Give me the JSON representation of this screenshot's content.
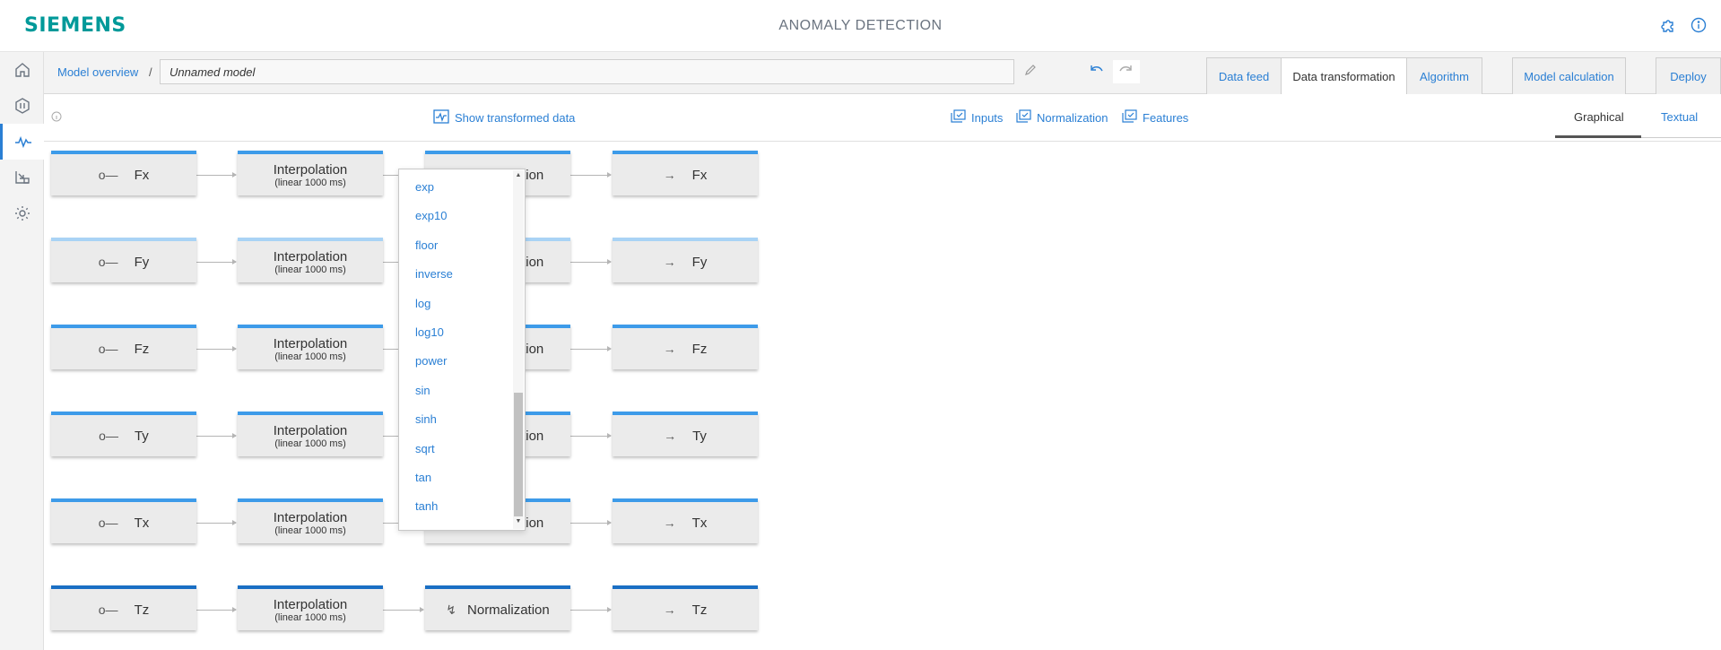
{
  "header": {
    "logo": "SIEMENS",
    "title": "ANOMALY DETECTION",
    "icons": [
      "puzzle-icon",
      "info-icon"
    ]
  },
  "rail": {
    "items": [
      {
        "name": "home-icon",
        "active": false
      },
      {
        "name": "hexagon-icon",
        "active": false
      },
      {
        "name": "signal-icon",
        "active": true
      },
      {
        "name": "import-icon",
        "active": false
      },
      {
        "name": "gear-icon",
        "active": false
      }
    ]
  },
  "toolbar": {
    "breadcrumb": "Model overview",
    "separator": "/",
    "model_name": "Unnamed model",
    "tabs": [
      "Data feed",
      "Data transformation",
      "Algorithm",
      "Model calculation",
      "Deploy"
    ],
    "active_tab": "Data transformation"
  },
  "subbar": {
    "show_transformed": "Show transformed data",
    "links": [
      "Inputs",
      "Normalization",
      "Features"
    ],
    "views": [
      "Graphical",
      "Textual"
    ],
    "active_view": "Graphical"
  },
  "pipeline": {
    "interp_title": "Interpolation",
    "interp_sub": "(linear 1000 ms)",
    "norm_title": "Normalization",
    "norm_visible_suffix": "ation",
    "rows": [
      {
        "signal": "Fx"
      },
      {
        "signal": "Fy"
      },
      {
        "signal": "Fz"
      },
      {
        "signal": "Ty"
      },
      {
        "signal": "Tx"
      },
      {
        "signal": "Tz"
      }
    ]
  },
  "dropdown": {
    "items": [
      "exp",
      "exp10",
      "floor",
      "inverse",
      "log",
      "log10",
      "power",
      "sin",
      "sinh",
      "sqrt",
      "tan",
      "tanh"
    ]
  },
  "colors": {
    "accent": "#2a7fd4",
    "brand": "#009999",
    "node_bg": "#ebebeb",
    "node_top": "#3d9be9"
  }
}
